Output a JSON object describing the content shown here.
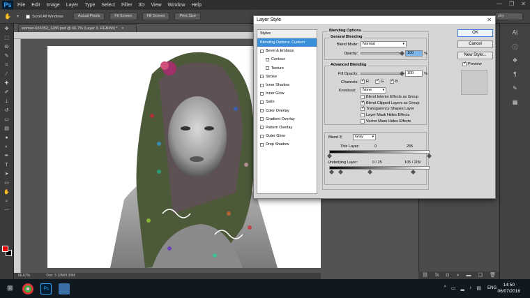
{
  "menu": {
    "logo": "Ps",
    "items": [
      "File",
      "Edit",
      "Image",
      "Layer",
      "Type",
      "Select",
      "Filter",
      "3D",
      "View",
      "Window",
      "Help"
    ]
  },
  "options_bar": {
    "scroll_all_label": "Scroll All Windows",
    "actual_pixels": "Actual Pixels",
    "fit_screen": "Fit Screen",
    "fill_screen": "Fill Screen",
    "print_size": "Print Size",
    "workspace": "phy"
  },
  "document": {
    "tab_title": "woman-659352_1280.psd @ 66.7% (Layer 3, RGB/8#) *",
    "zoom": "66.67%",
    "doc_size": "Doc: 3.12M/9.30M"
  },
  "dialog": {
    "title": "Layer Style",
    "styles_header": "Styles",
    "styles": [
      {
        "label": "Blending Options: Custom",
        "selected": true,
        "checkbox": false,
        "sub": false
      },
      {
        "label": "Bevel & Emboss",
        "selected": false,
        "checkbox": true,
        "sub": false
      },
      {
        "label": "Contour",
        "selected": false,
        "checkbox": true,
        "sub": true
      },
      {
        "label": "Texture",
        "selected": false,
        "checkbox": true,
        "sub": true
      },
      {
        "label": "Stroke",
        "selected": false,
        "checkbox": true,
        "sub": false
      },
      {
        "label": "Inner Shadow",
        "selected": false,
        "checkbox": true,
        "sub": false
      },
      {
        "label": "Inner Glow",
        "selected": false,
        "checkbox": true,
        "sub": false
      },
      {
        "label": "Satin",
        "selected": false,
        "checkbox": true,
        "sub": false
      },
      {
        "label": "Color Overlay",
        "selected": false,
        "checkbox": true,
        "sub": false
      },
      {
        "label": "Gradient Overlay",
        "selected": false,
        "checkbox": true,
        "sub": false
      },
      {
        "label": "Pattern Overlay",
        "selected": false,
        "checkbox": true,
        "sub": false
      },
      {
        "label": "Outer Glow",
        "selected": false,
        "checkbox": true,
        "sub": false
      },
      {
        "label": "Drop Shadow",
        "selected": false,
        "checkbox": true,
        "sub": false
      }
    ],
    "blending_options": "Blending Options",
    "general_blending": "General Blending",
    "blend_mode_label": "Blend Mode:",
    "blend_mode_value": "Normal",
    "opacity_label": "Opacity:",
    "opacity_value": "100",
    "percent": "%",
    "advanced_blending": "Advanced Blending",
    "fill_opacity_label": "Fill Opacity:",
    "fill_opacity_value": "100",
    "channels_label": "Channels:",
    "channel_r": "R",
    "channel_g": "G",
    "channel_b": "B",
    "knockout_label": "Knockout:",
    "knockout_value": "None",
    "checks": [
      {
        "label": "Blend Interior Effects as Group",
        "checked": false
      },
      {
        "label": "Blend Clipped Layers as Group",
        "checked": true
      },
      {
        "label": "Transparency Shapes Layer",
        "checked": true
      },
      {
        "label": "Layer Mask Hides Effects",
        "checked": false
      },
      {
        "label": "Vector Mask Hides Effects",
        "checked": false
      }
    ],
    "blend_if_label": "Blend If:",
    "blend_if_value": "Gray",
    "this_layer_label": "This Layer:",
    "this_layer_low": "0",
    "this_layer_high": "255",
    "underlying_label": "Underlying Layer:",
    "underlying_values": "0  /  25",
    "underlying_values_high": "105  /  209",
    "ok": "OK",
    "cancel": "Cancel",
    "new_style": "New Style...",
    "preview": "Preview"
  },
  "taskbar": {
    "lang": "ENG",
    "time": "14:50",
    "date": "06/07/2016"
  }
}
